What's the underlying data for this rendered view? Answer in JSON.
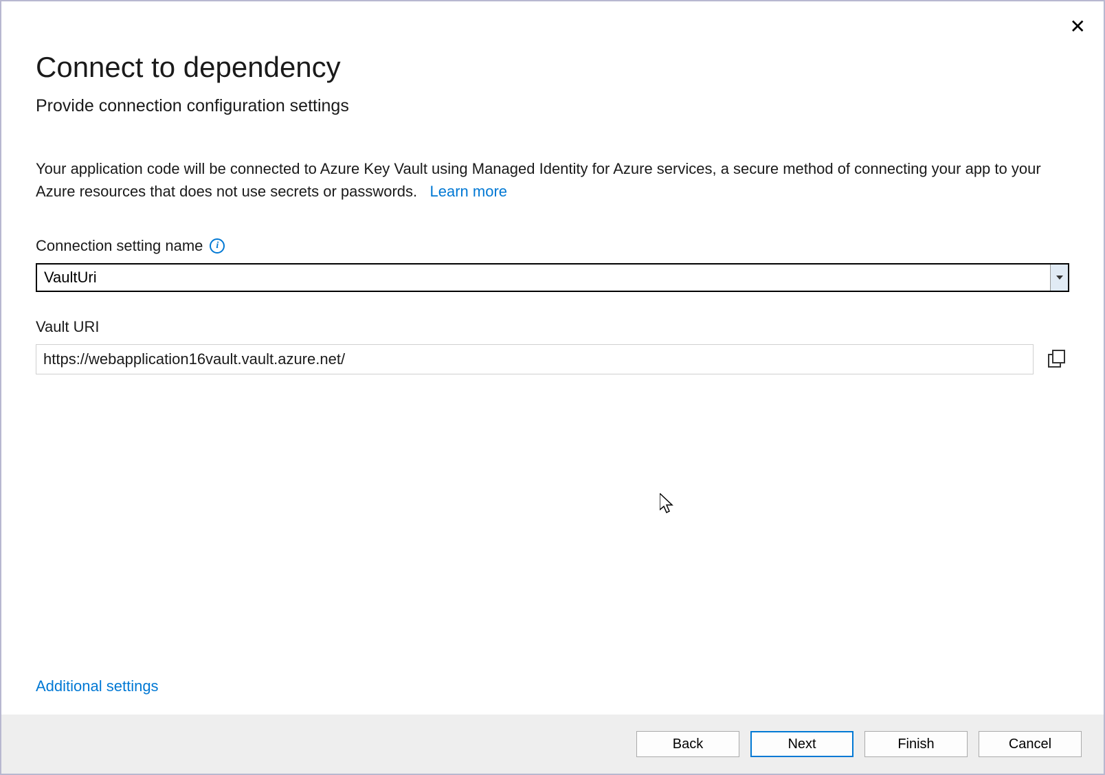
{
  "dialog": {
    "title": "Connect to dependency",
    "subtitle": "Provide connection configuration settings",
    "description": "Your application code will be connected to Azure Key Vault using Managed Identity for Azure services, a secure method of connecting your app to your Azure resources that does not use secrets or passwords.",
    "learn_more": "Learn more"
  },
  "fields": {
    "connection_setting": {
      "label": "Connection setting name",
      "value": "VaultUri"
    },
    "vault_uri": {
      "label": "Vault URI",
      "value": "https://webapplication16vault.vault.azure.net/"
    }
  },
  "links": {
    "additional_settings": "Additional settings"
  },
  "buttons": {
    "back": "Back",
    "next": "Next",
    "finish": "Finish",
    "cancel": "Cancel"
  }
}
